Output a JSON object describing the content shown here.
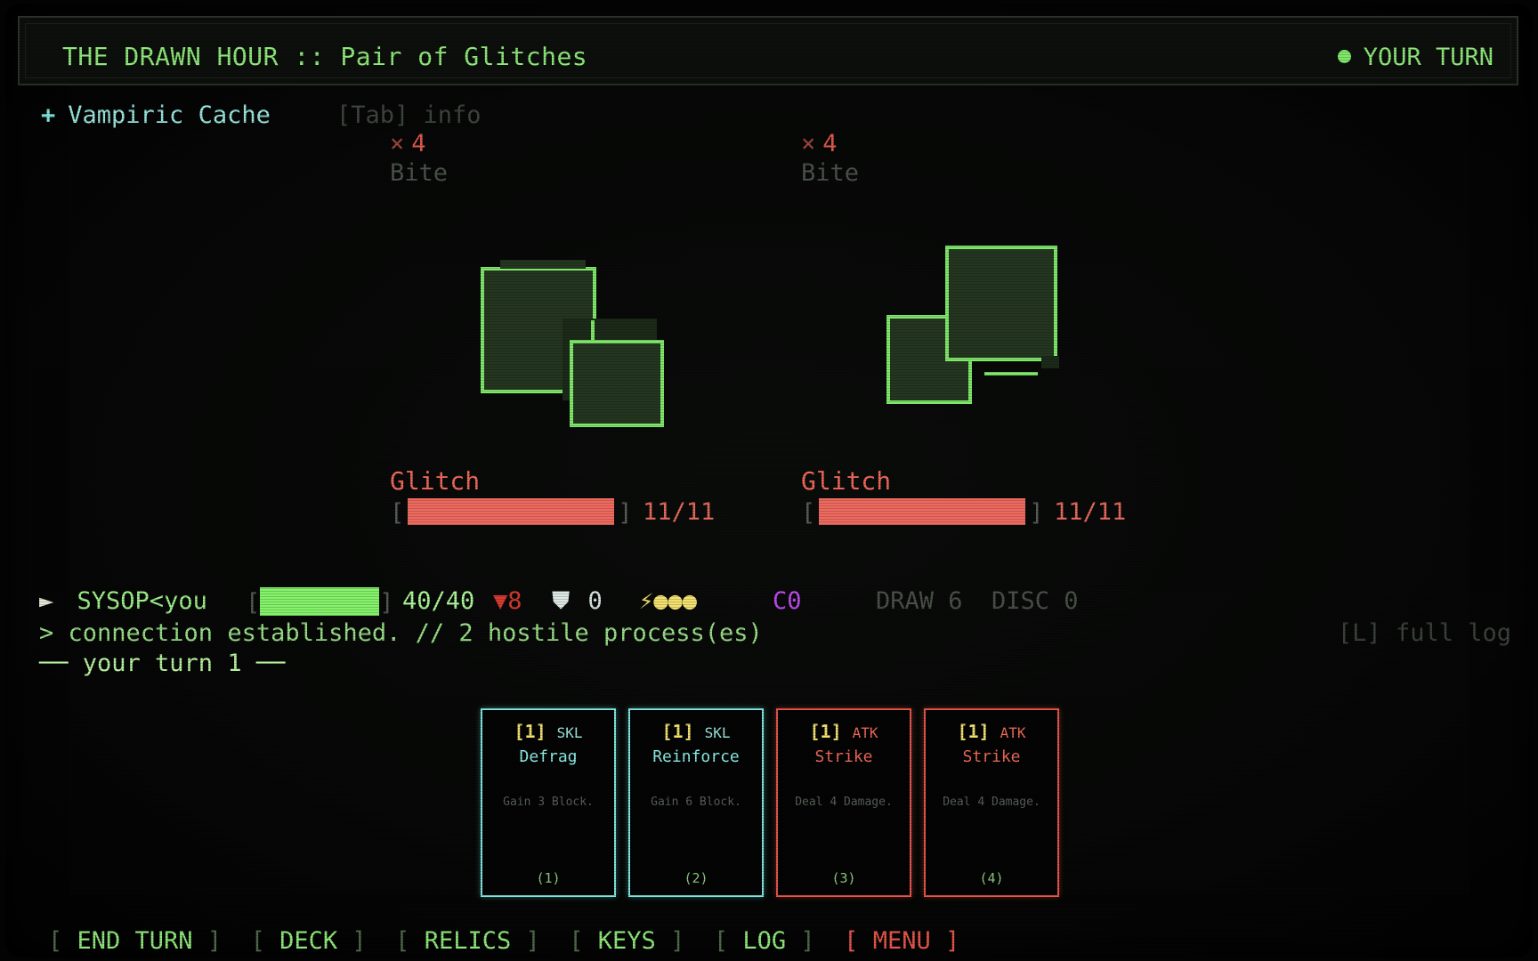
{
  "header": {
    "title": "THE DRAWN HOUR :: Pair of Glitches",
    "turn_status": "YOUR TURN"
  },
  "relic": {
    "icon": "+",
    "name": "Vampiric Cache",
    "hint": "[Tab] info"
  },
  "enemies": [
    {
      "intent_icon": "⨯",
      "intent_value": "4",
      "intent_name": "Bite",
      "name": "Glitch",
      "hp_text": "11/11",
      "hp_fraction": 1.0
    },
    {
      "intent_icon": "⨯",
      "intent_value": "4",
      "intent_name": "Bite",
      "name": "Glitch",
      "hp_text": "11/11",
      "hp_fraction": 1.0
    }
  ],
  "player": {
    "cursor": "►",
    "name": "SYSOP<you",
    "hp_text": "40/40",
    "hp_fraction": 1.0,
    "buff": "▼8",
    "block_icon": "shield-icon",
    "block": "0",
    "energy": "⚡●●●",
    "c_value": "C0",
    "draw": "DRAW 6",
    "discard": "DISC 0"
  },
  "log": {
    "line": "> connection established. // 2 hostile process(es)",
    "full_log_hint": "[L] full log",
    "turn_line": "── your turn 1 ──"
  },
  "hand": [
    {
      "cost": "[1]",
      "type": "SKL",
      "name": "Defrag",
      "desc": "Gain 3 Block.",
      "index": "(1)",
      "kind": "skl"
    },
    {
      "cost": "[1]",
      "type": "SKL",
      "name": "Reinforce",
      "desc": "Gain 6 Block.",
      "index": "(2)",
      "kind": "skl"
    },
    {
      "cost": "[1]",
      "type": "ATK",
      "name": "Strike",
      "desc": "Deal 4 Damage.",
      "index": "(3)",
      "kind": "atk"
    },
    {
      "cost": "[1]",
      "type": "ATK",
      "name": "Strike",
      "desc": "Deal 4 Damage.",
      "index": "(4)",
      "kind": "atk"
    }
  ],
  "menu": {
    "end_turn": "END TURN",
    "deck": "DECK",
    "relics": "RELICS",
    "keys": "KEYS",
    "log": "LOG",
    "menu": "MENU"
  },
  "colors": {
    "terminal_green": "#8fe87a",
    "enemy_red": "#ee6a5f",
    "skill_cyan": "#7fe7e0",
    "energy_yellow": "#f2e070"
  }
}
